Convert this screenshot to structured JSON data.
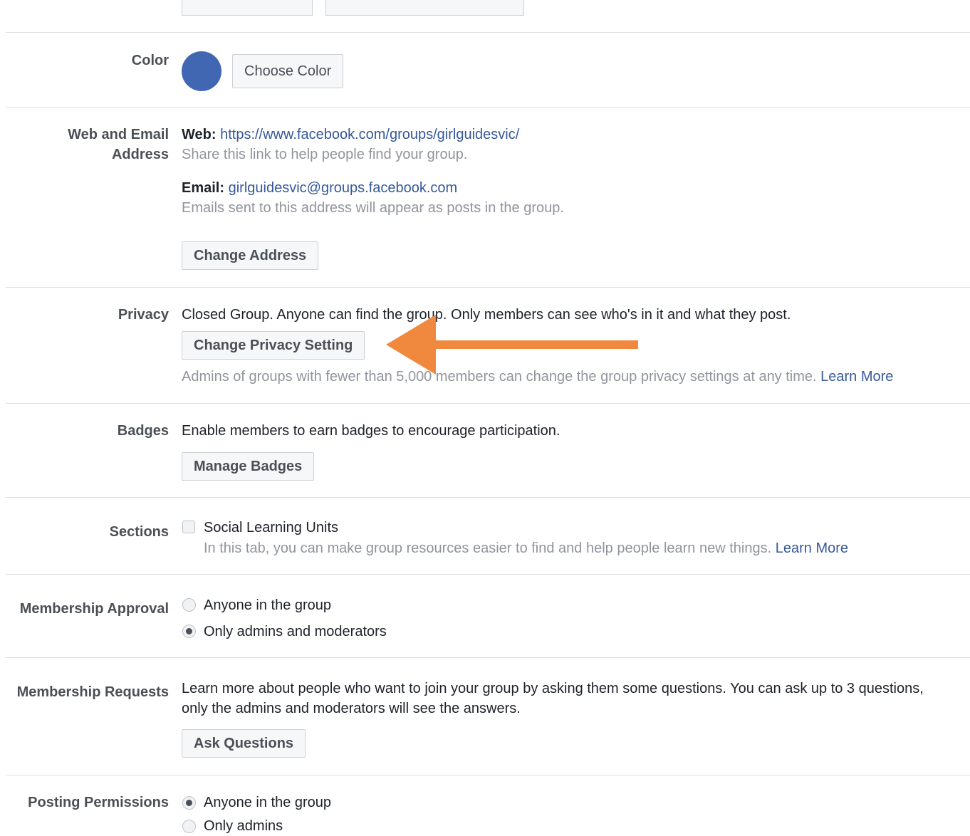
{
  "colors": {
    "group_color": "#4267b2",
    "arrow": "#f0883e",
    "link": "#365899"
  },
  "color_section": {
    "label": "Color",
    "button": "Choose Color"
  },
  "address_section": {
    "label_line1": "Web and Email",
    "label_line2": "Address",
    "web_label": "Web:",
    "web_url": "https://www.facebook.com/groups/girlguidesvic/",
    "web_hint": "Share this link to help people find your group.",
    "email_label": "Email:",
    "email_value": "girlguidesvic@groups.facebook.com",
    "email_hint": "Emails sent to this address will appear as posts in the group.",
    "button": "Change Address"
  },
  "privacy_section": {
    "label": "Privacy",
    "description": "Closed Group. Anyone can find the group. Only members can see who's in it and what they post.",
    "button": "Change Privacy Setting",
    "hint": "Admins of groups with fewer than 5,000 members can change the group privacy settings at any time.",
    "learn_more": "Learn More",
    "annotation_icon": "arrow-left-icon"
  },
  "badges_section": {
    "label": "Badges",
    "description": "Enable members to earn badges to encourage participation.",
    "button": "Manage Badges"
  },
  "sections_section": {
    "label": "Sections",
    "checkbox_label": "Social Learning Units",
    "checkbox_checked": false,
    "hint": "In this tab, you can make group resources easier to find and help people learn new things.",
    "learn_more": "Learn More"
  },
  "membership_approval": {
    "label": "Membership Approval",
    "options": [
      {
        "label": "Anyone in the group",
        "selected": false
      },
      {
        "label": "Only admins and moderators",
        "selected": true
      }
    ]
  },
  "membership_requests": {
    "label": "Membership Requests",
    "description_line1": "Learn more about people who want to join your group by asking them some questions. You can ask up to 3 questions,",
    "description_line2": "only the admins and moderators will see the answers.",
    "button": "Ask Questions"
  },
  "posting_permissions": {
    "label": "Posting Permissions",
    "options": [
      {
        "label": "Anyone in the group",
        "selected": true
      },
      {
        "label": "Only admins",
        "selected": false
      }
    ]
  }
}
